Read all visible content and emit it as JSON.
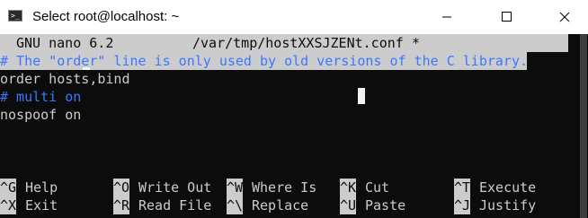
{
  "window": {
    "icon_text": ">_",
    "title": "Select root@localhost: ~",
    "icons": [
      "terminal-icon",
      "minimize-icon",
      "maximize-icon",
      "close-icon"
    ]
  },
  "nano": {
    "version": "GNU nano 6.2",
    "filename": "/var/tmp/hostXXSJZENt.conf",
    "modified_flag": "*",
    "lines": [
      "# The \"order\" line is only used by old versions of the C library.",
      "order hosts,bind",
      "# multi on",
      "nospoof on"
    ],
    "shortcuts_row1": [
      {
        "key": "^G",
        "label": "Help"
      },
      {
        "key": "^O",
        "label": "Write Out"
      },
      {
        "key": "^W",
        "label": "Where Is"
      },
      {
        "key": "^K",
        "label": "Cut"
      },
      {
        "key": "^T",
        "label": "Execute"
      }
    ],
    "shortcuts_row2": [
      {
        "key": "^X",
        "label": "Exit"
      },
      {
        "key": "^R",
        "label": "Read File"
      },
      {
        "key": "^\\",
        "label": "Replace"
      },
      {
        "key": "^U",
        "label": "Paste"
      },
      {
        "key": "^J",
        "label": "Justify"
      }
    ]
  },
  "colors": {
    "background": "#0c0c0c",
    "foreground": "#cccccc",
    "comment": "#3b78ff",
    "inverse_bg": "#cccccc"
  }
}
